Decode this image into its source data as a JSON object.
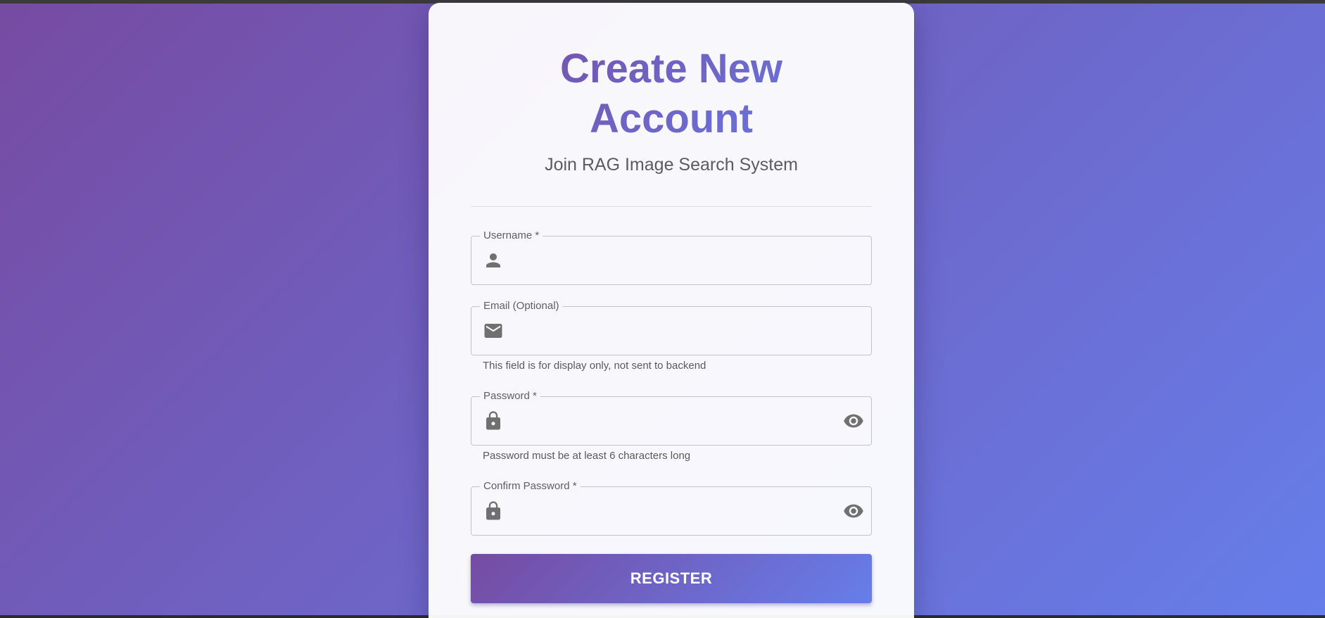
{
  "header": {
    "title_line1": "Create New",
    "title_line2": "Account",
    "subtitle": "Join RAG Image Search System"
  },
  "fields": [
    {
      "label": "Username *",
      "value": "",
      "icon": "person-icon"
    },
    {
      "label": "Email (Optional)",
      "value": "",
      "icon": "mail-icon",
      "helper": "This field is for display only, not sent to backend"
    },
    {
      "label": "Password *",
      "value": "",
      "icon": "lock-icon",
      "trailing_icon": "eye-icon",
      "helper": "Password must be at least 6 characters long"
    },
    {
      "label": "Confirm Password *",
      "value": "",
      "icon": "lock-icon",
      "trailing_icon": "eye-icon"
    }
  ],
  "actions": {
    "register_label": "REGISTER"
  },
  "colors": {
    "gradient_start": "#764ba2",
    "gradient_end": "#667eea",
    "icon": "#707070",
    "card": "#f7f6fb"
  }
}
